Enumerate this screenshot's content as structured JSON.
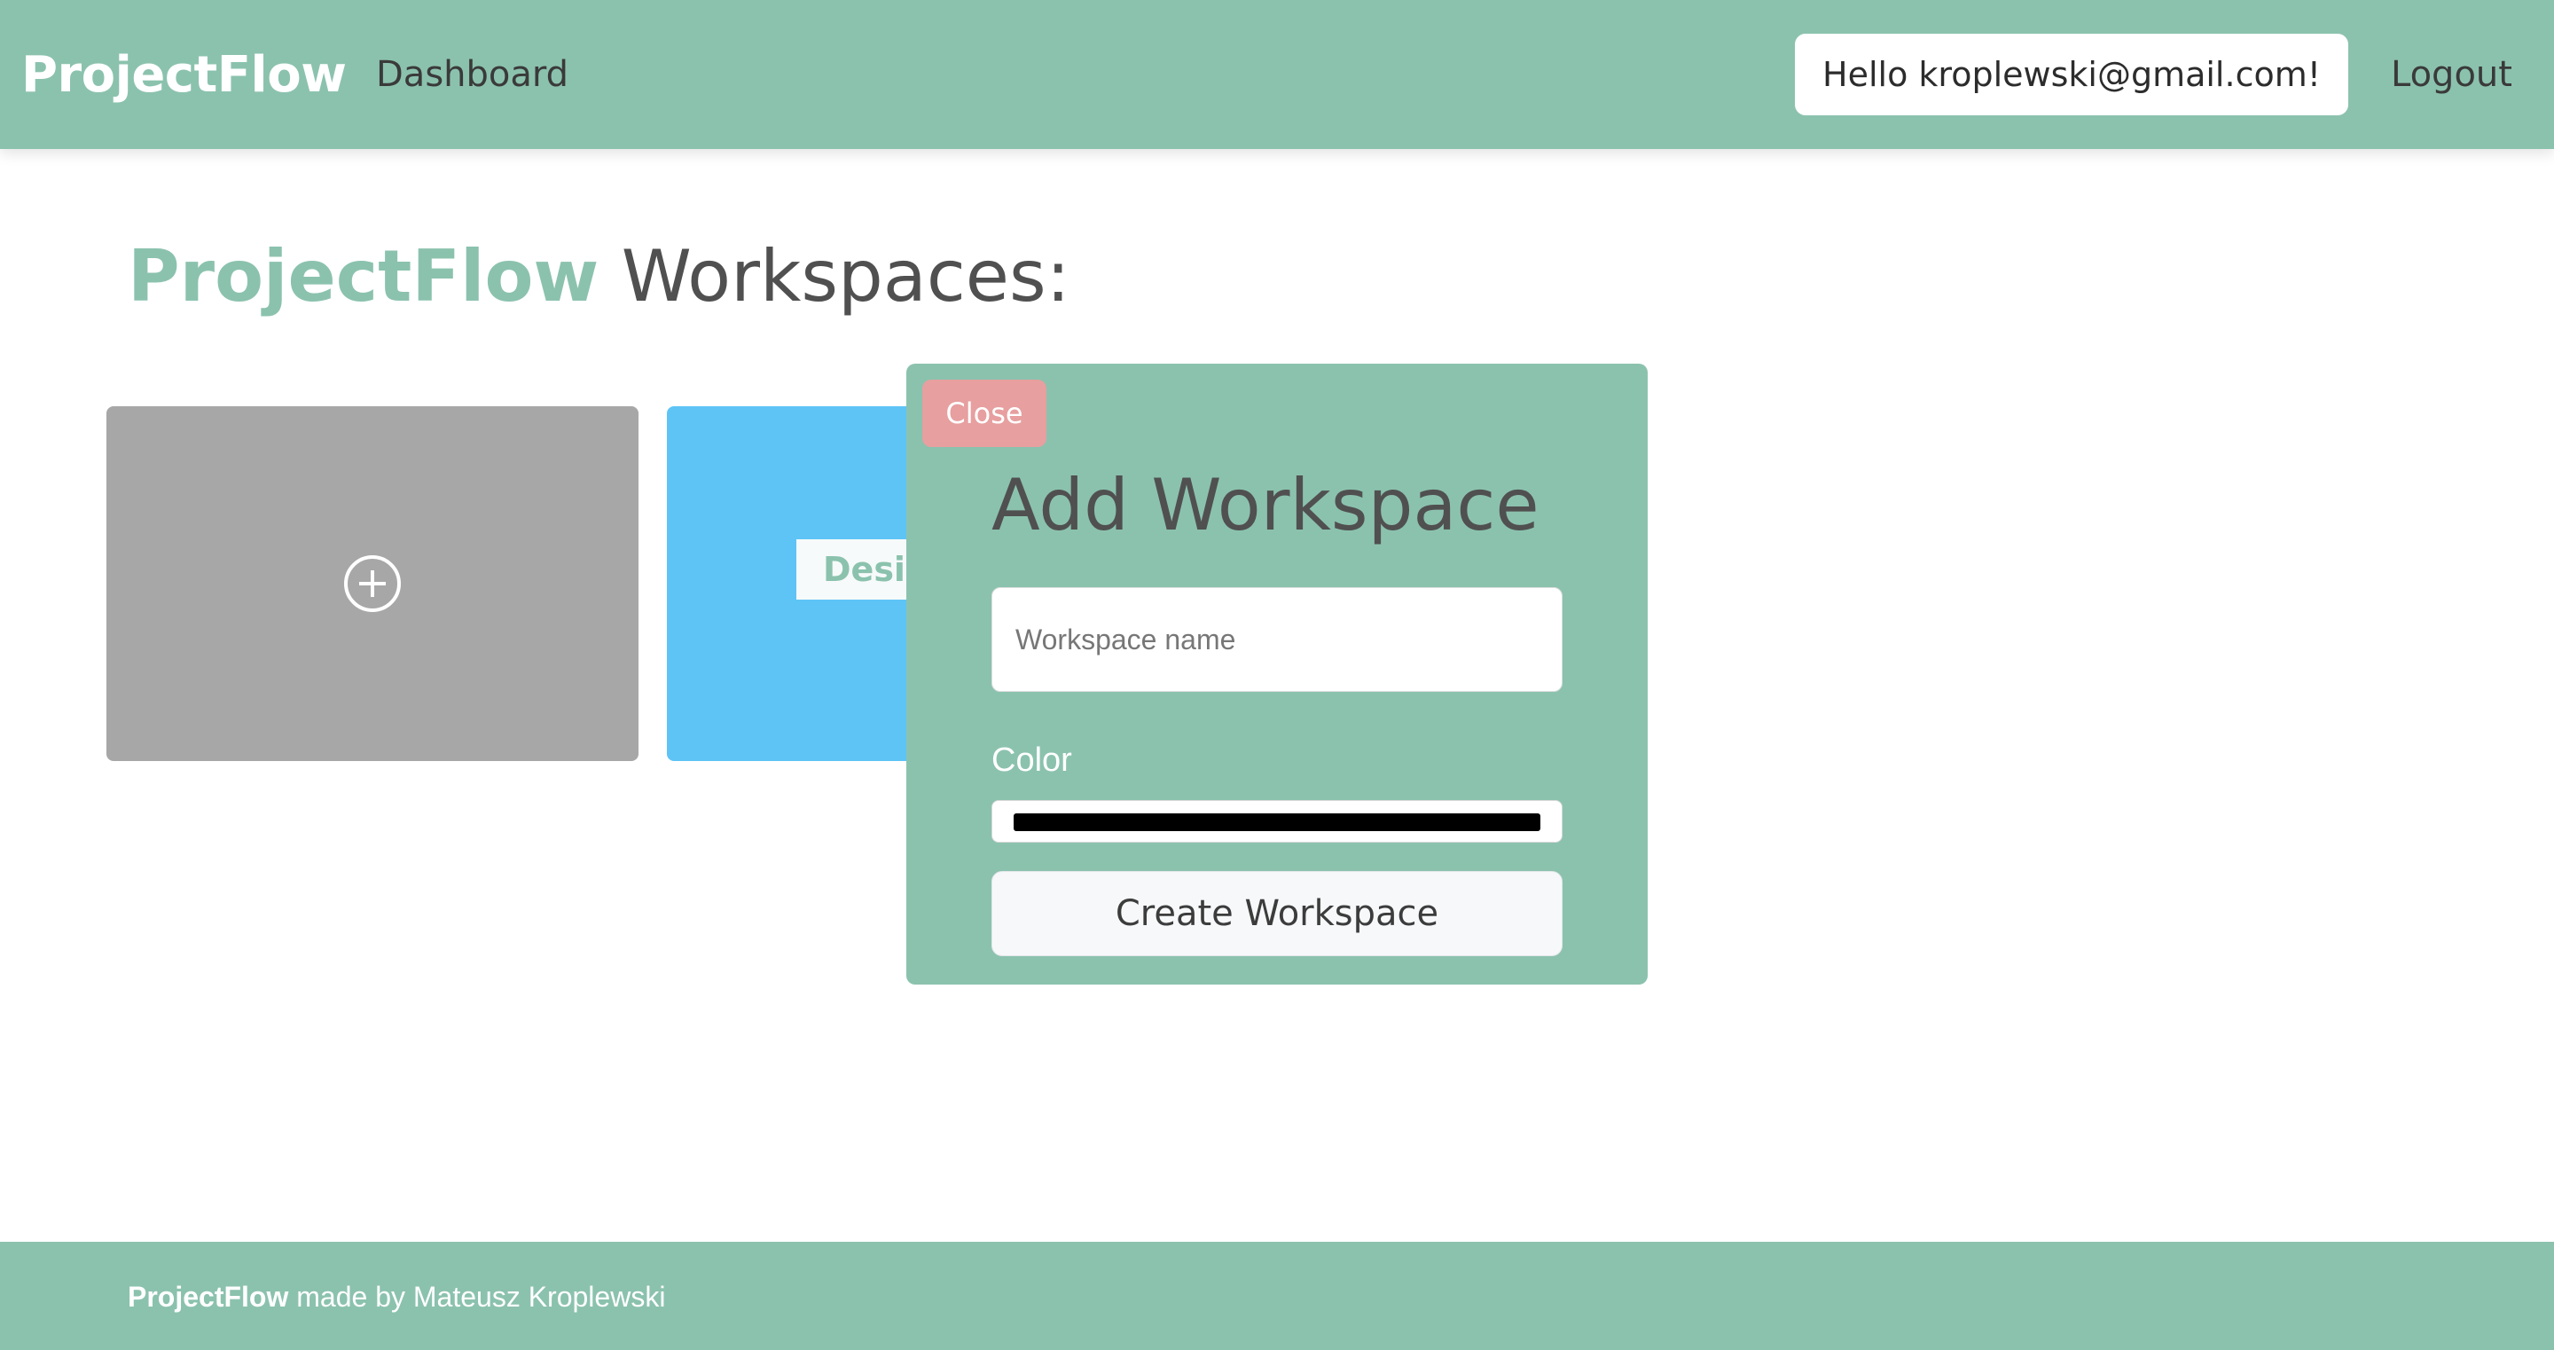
{
  "navbar": {
    "brand": "ProjectFlow",
    "dashboard_link": "Dashboard",
    "greeting": "Hello kroplewski@gmail.com!",
    "logout_link": "Logout"
  },
  "page": {
    "title_accent": "ProjectFlow",
    "title_rest": " Workspaces:"
  },
  "workspaces": {
    "add_card_icon": "plus-circle-icon",
    "items": [
      {
        "name": "Design",
        "color": "#5ec4f6"
      }
    ]
  },
  "modal": {
    "close_label": "Close",
    "title": "Add Workspace",
    "name_placeholder": "Workspace name",
    "name_value": "",
    "color_label": "Color",
    "color_value": "#000000",
    "submit_label": "Create Workspace"
  },
  "footer": {
    "brand": "ProjectFlow",
    "credit": " made by Mateusz Kroplewski"
  },
  "colors": {
    "accent": "#8bc2ae",
    "close_button": "#e79f9f",
    "add_card": "#a7a7a7"
  }
}
